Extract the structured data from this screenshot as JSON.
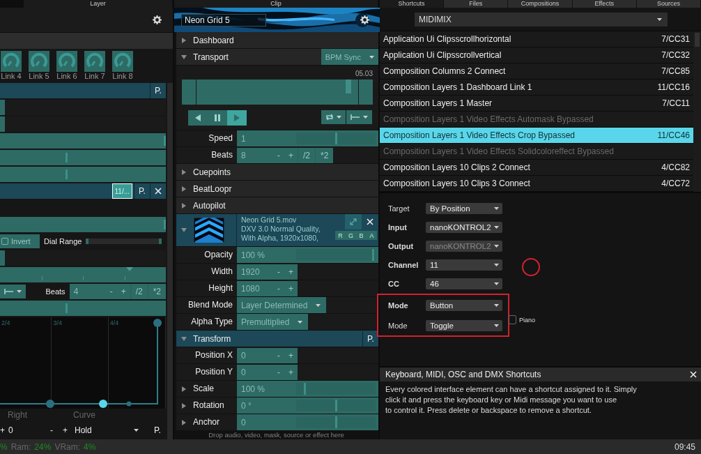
{
  "layer_panel": {
    "tab": "Layer",
    "knobs": [
      "Link 4",
      "Link 5",
      "Link 6",
      "Link 7",
      "Link 8"
    ],
    "rows": [
      {
        "kind": "param-bar",
        "buttons": [
          "P."
        ],
        "closable": false
      },
      {
        "kind": "fill",
        "level": 0.03
      },
      {
        "kind": "fill",
        "level": 0.03
      },
      {
        "kind": "slider",
        "level": 1
      },
      {
        "kind": "slider",
        "level": 0.4
      },
      {
        "kind": "slider",
        "level": 0.4
      },
      {
        "kind": "param-bar",
        "shortcut": "11/...",
        "buttons": [
          "P."
        ],
        "closable": true
      },
      {
        "kind": "empty"
      },
      {
        "kind": "slider",
        "level": 1
      },
      {
        "kind": "invert",
        "label": "Invert",
        "checked": false,
        "range_label": "Dial Range"
      },
      {
        "kind": "fill",
        "level": 0.03
      },
      {
        "kind": "timeline",
        "level": 0.78
      },
      {
        "kind": "beats",
        "label": "Beats",
        "value": "4",
        "buttons": [
          "-",
          "+",
          "/2",
          "*2"
        ]
      },
      {
        "kind": "slider",
        "level": 0.4
      },
      {
        "kind": "envelope",
        "ticks": [
          "2/4",
          "3/4",
          "4/4"
        ]
      },
      {
        "kind": "labels",
        "labels": [
          "Right",
          "Curve"
        ]
      },
      {
        "kind": "curve",
        "items": [
          "+",
          "0",
          "-",
          "+",
          "Hold"
        ],
        "button": "P."
      }
    ]
  },
  "clip_panel": {
    "tab": "Clip",
    "name": "Neon Grid 5",
    "rows": [
      {
        "kind": "section",
        "label": "Dashboard",
        "expanded": false
      },
      {
        "kind": "section",
        "label": "Transport",
        "expanded": true,
        "dropdown": "BPM Sync"
      },
      {
        "kind": "transport",
        "time": "05.03",
        "level": 0.94,
        "buttons": [
          {
            "kind": "back",
            "selected": false
          },
          {
            "kind": "pause",
            "selected": false
          },
          {
            "kind": "play",
            "selected": true
          }
        ]
      },
      {
        "kind": "slider-param",
        "label": "Speed",
        "value": "1",
        "level": 0.5
      },
      {
        "kind": "stepper-param",
        "label": "Beats",
        "value": "8",
        "buttons": [
          "-",
          "+",
          "/2",
          "*2"
        ]
      },
      {
        "kind": "section",
        "label": "Cuepoints",
        "expanded": false
      },
      {
        "kind": "section",
        "label": "BeatLoopr",
        "expanded": false
      },
      {
        "kind": "section",
        "label": "Autopilot",
        "expanded": false
      },
      {
        "kind": "source",
        "expanded": true,
        "file": "Neon Grid 5.mov",
        "info": [
          "DXV 3.0 Normal Quality,",
          "With Alpha, 1920x1080,"
        ],
        "channels": [
          "R",
          "G",
          "B",
          "A"
        ]
      },
      {
        "kind": "slider-param",
        "label": "Opacity",
        "value": "100 %",
        "level": 0.98
      },
      {
        "kind": "stepper-param",
        "label": "Width",
        "value": "1920",
        "buttons": [
          "-",
          "+"
        ]
      },
      {
        "kind": "stepper-param",
        "label": "Height",
        "value": "1080",
        "buttons": [
          "-",
          "+"
        ]
      },
      {
        "kind": "dropdown-param",
        "label": "Blend Mode",
        "value": "Layer Determined"
      },
      {
        "kind": "dropdown-param",
        "label": "Alpha Type",
        "value": "Premultiplied"
      },
      {
        "kind": "section",
        "label": "Transform",
        "expanded": true,
        "button": "P."
      },
      {
        "kind": "stepper-param",
        "label": "Position X",
        "value": "0",
        "buttons": [
          "-",
          "+"
        ]
      },
      {
        "kind": "stepper-param",
        "label": "Position Y",
        "value": "0",
        "buttons": [
          "-",
          "+"
        ]
      },
      {
        "kind": "slider-param",
        "label": "Scale",
        "value": "100 %",
        "level": 0.1,
        "expanded": false
      },
      {
        "kind": "slider-param",
        "label": "Rotation",
        "value": "0 °",
        "level": 0.5,
        "expanded": false
      },
      {
        "kind": "slider-param",
        "label": "Anchor",
        "value": "0",
        "level": 0.5,
        "expanded": false
      }
    ],
    "hint": "Drop audio, video, mask, source or effect here"
  },
  "browser": {
    "tabs": [
      {
        "label": "Shortcuts",
        "selected": true
      },
      {
        "label": "Files",
        "selected": false
      },
      {
        "label": "Compositions",
        "selected": false
      },
      {
        "label": "Effects",
        "selected": false
      },
      {
        "label": "Sources",
        "selected": false
      }
    ],
    "preset": "MIDIMIX",
    "shortcuts": [
      {
        "action": "Application Ui Clipsscrollhorizontal",
        "key": "7/CC31",
        "disabled": false,
        "selected": false
      },
      {
        "action": "Application Ui Clipsscrollvertical",
        "key": "7/CC32",
        "disabled": false,
        "selected": false
      },
      {
        "action": "Composition Columns 2 Connect",
        "key": "7/CC85",
        "disabled": false,
        "selected": false
      },
      {
        "action": "Composition Layers 1 Dashboard Link 1",
        "key": "11/CC16",
        "disabled": false,
        "selected": false
      },
      {
        "action": "Composition Layers 1 Master",
        "key": "7/CC11",
        "disabled": false,
        "selected": false
      },
      {
        "action": "Composition Layers 1 Video Effects Automask Bypassed",
        "disabled": true,
        "selected": false
      },
      {
        "action": "Composition Layers 1 Video Effects Crop Bypassed",
        "key": "11/CC46",
        "disabled": false,
        "selected": true
      },
      {
        "action": "Composition Layers 1 Video Effects Solidcoloreffect Bypassed",
        "disabled": true,
        "selected": false
      },
      {
        "action": "Composition Layers 10 Clips 2 Connect",
        "key": "4/CC82",
        "disabled": false,
        "selected": false
      },
      {
        "action": "Composition Layers 10 Clips 3 Connect",
        "key": "4/CC72",
        "disabled": false,
        "selected": false
      }
    ],
    "settings": [
      {
        "label": "Target",
        "value": "By Position",
        "bold": false,
        "disabled": false,
        "highlighted": false
      },
      {
        "label": "Input",
        "value": "nanoKONTROL2",
        "bold": true,
        "disabled": false,
        "highlighted": false
      },
      {
        "label": "Output",
        "value": "nanoKONTROL2",
        "bold": true,
        "disabled": true,
        "highlighted": false
      },
      {
        "label": "Channel",
        "value": "11",
        "bold": true,
        "disabled": false,
        "highlighted": false
      },
      {
        "label": "CC",
        "value": "46",
        "bold": true,
        "disabled": false,
        "highlighted": false
      },
      {
        "label": "Mode",
        "value": "Button",
        "bold": true,
        "disabled": false,
        "highlighted": true
      },
      {
        "label": "Mode",
        "value": "Toggle",
        "bold": false,
        "disabled": false,
        "highlighted": true
      }
    ],
    "piano": {
      "label": "Piano",
      "checked": false
    },
    "help": {
      "title": "Keyboard, MIDI, OSC and DMX Shortcuts",
      "text": "Every colored interface element can have a shortcut assigned to it. Simply\nclick it and press the keyboard key or Midi message you want to use\nto control it. Press delete or backspace to remove a shortcut."
    }
  },
  "status_bar": {
    "cut_value": "%",
    "meters": [
      {
        "label": "Ram:",
        "value": "24%"
      },
      {
        "label": "VRam:",
        "value": "4%"
      }
    ],
    "clock": "09:45"
  }
}
